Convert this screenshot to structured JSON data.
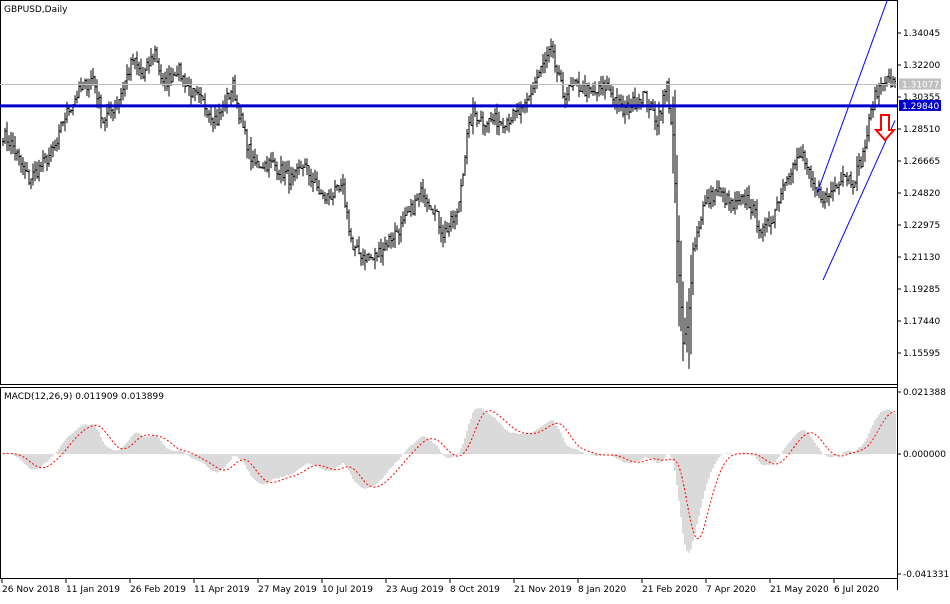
{
  "chart_data": {
    "type": "bar",
    "symbol_title": "GBPUSD,Daily",
    "price_axis_ticks": [
      "1.34045",
      "1.32200",
      "1.30355",
      "1.28510",
      "1.26665",
      "1.24820",
      "1.22975",
      "1.21130",
      "1.19285",
      "1.17440",
      "1.15595"
    ],
    "price_range": [
      1.14,
      1.36
    ],
    "current_price_label": "1.31077",
    "current_price": 1.31077,
    "hline_label": "1.29840",
    "hline_price": 1.2984,
    "x_tick_labels": [
      "26 Nov 2018",
      "11 Jan 2019",
      "26 Feb 2019",
      "11 Apr 2019",
      "27 May 2019",
      "10 Jul 2019",
      "23 Aug 2019",
      "8 Oct 2019",
      "21 Nov 2019",
      "8 Jan 2020",
      "21 Feb 2020",
      "7 Apr 2020",
      "21 May 2020",
      "6 Jul 2020"
    ],
    "close_waypoints": [
      [
        0,
        1.282
      ],
      [
        5,
        1.275
      ],
      [
        10,
        1.262
      ],
      [
        13,
        1.256
      ],
      [
        20,
        1.265
      ],
      [
        27,
        1.276
      ],
      [
        30,
        1.29
      ],
      [
        37,
        1.305
      ],
      [
        45,
        1.315
      ],
      [
        50,
        1.29
      ],
      [
        57,
        1.3
      ],
      [
        65,
        1.325
      ],
      [
        70,
        1.315
      ],
      [
        76,
        1.33
      ],
      [
        80,
        1.31
      ],
      [
        87,
        1.32
      ],
      [
        95,
        1.305
      ],
      [
        100,
        1.3
      ],
      [
        107,
        1.29
      ],
      [
        115,
        1.31
      ],
      [
        120,
        1.285
      ],
      [
        125,
        1.265
      ],
      [
        135,
        1.265
      ],
      [
        145,
        1.255
      ],
      [
        150,
        1.265
      ],
      [
        160,
        1.245
      ],
      [
        170,
        1.25
      ],
      [
        175,
        1.215
      ],
      [
        185,
        1.21
      ],
      [
        192,
        1.22
      ],
      [
        200,
        1.23
      ],
      [
        210,
        1.25
      ],
      [
        215,
        1.24
      ],
      [
        220,
        1.225
      ],
      [
        227,
        1.235
      ],
      [
        232,
        1.28
      ],
      [
        235,
        1.295
      ],
      [
        240,
        1.29
      ],
      [
        250,
        1.29
      ],
      [
        260,
        1.295
      ],
      [
        267,
        1.315
      ],
      [
        274,
        1.33
      ],
      [
        280,
        1.305
      ],
      [
        287,
        1.31
      ],
      [
        295,
        1.305
      ],
      [
        302,
        1.31
      ],
      [
        310,
        1.295
      ],
      [
        320,
        1.305
      ],
      [
        327,
        1.29
      ],
      [
        332,
        1.31
      ],
      [
        335,
        1.28
      ],
      [
        337,
        1.22
      ],
      [
        340,
        1.16
      ],
      [
        342,
        1.17
      ],
      [
        345,
        1.215
      ],
      [
        350,
        1.24
      ],
      [
        357,
        1.25
      ],
      [
        365,
        1.24
      ],
      [
        372,
        1.245
      ],
      [
        380,
        1.225
      ],
      [
        385,
        1.235
      ],
      [
        392,
        1.26
      ],
      [
        400,
        1.27
      ],
      [
        405,
        1.25
      ],
      [
        412,
        1.245
      ],
      [
        420,
        1.26
      ],
      [
        425,
        1.255
      ],
      [
        430,
        1.27
      ],
      [
        435,
        1.3
      ],
      [
        440,
        1.315
      ],
      [
        446,
        1.31
      ]
    ],
    "trend_channel": [
      {
        "from": [
          407,
          1.248
        ],
        "to": [
          443,
          1.362
        ]
      },
      {
        "from": [
          410,
          1.198
        ],
        "to": [
          446,
          1.29
        ]
      }
    ],
    "signal_arrow": "down",
    "macd": {
      "label": "MACD(12,26,9) 0.011909 0.013899",
      "axis_ticks": [
        "0.021388",
        "0.000000",
        "-0.041331"
      ],
      "range": [
        -0.041331,
        0.021388
      ]
    },
    "colors": {
      "bars": "#000000",
      "hline": "#0000cc",
      "trend": "#0000ff",
      "arrow": "#ff0000",
      "macd_hist": "#b4b4b4",
      "macd_signal": "#ff0000",
      "current": "#c0c0c0"
    }
  }
}
